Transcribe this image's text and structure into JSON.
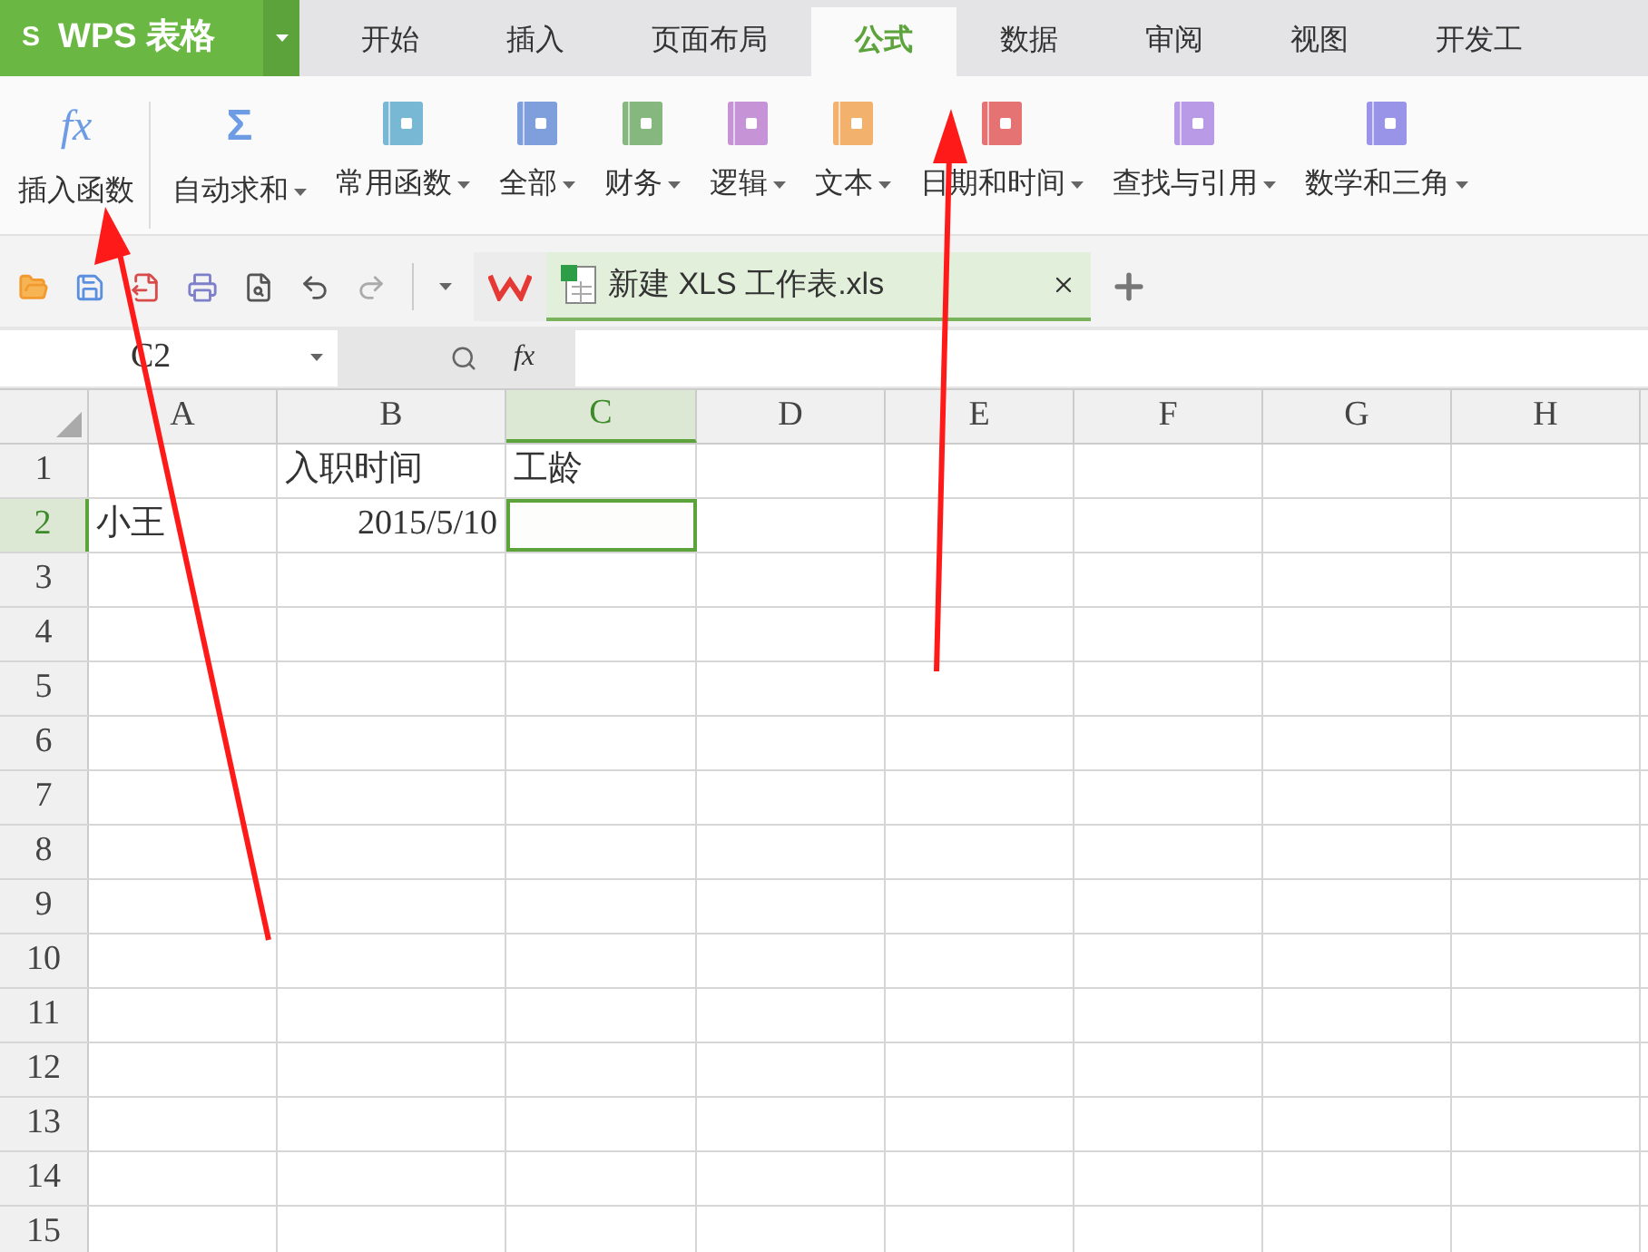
{
  "app_button": {
    "label": "WPS 表格",
    "logo": "S"
  },
  "tabs": [
    {
      "label": "开始",
      "selected": false
    },
    {
      "label": "插入",
      "selected": false
    },
    {
      "label": "页面布局",
      "selected": false
    },
    {
      "label": "公式",
      "selected": true
    },
    {
      "label": "数据",
      "selected": false
    },
    {
      "label": "审阅",
      "selected": false
    },
    {
      "label": "视图",
      "selected": false
    },
    {
      "label": "开发工",
      "selected": false
    }
  ],
  "ribbon": [
    {
      "kind": "glyph",
      "icon_text": "fx",
      "label": "插入函数",
      "has_menu": false
    },
    {
      "kind": "glyph",
      "icon_text": "Σ",
      "label": "自动求和",
      "has_menu": true
    },
    {
      "kind": "book",
      "color": "#78b8d4",
      "label": "常用函数",
      "has_menu": true
    },
    {
      "kind": "book",
      "color": "#7f9fdc",
      "label": "全部",
      "has_menu": true
    },
    {
      "kind": "book",
      "color": "#86b77e",
      "label": "财务",
      "has_menu": true
    },
    {
      "kind": "book",
      "color": "#c694d6",
      "label": "逻辑",
      "has_menu": true
    },
    {
      "kind": "book",
      "color": "#f2b26e",
      "label": "文本",
      "has_menu": true
    },
    {
      "kind": "book",
      "color": "#e57373",
      "label": "日期和时间",
      "has_menu": true
    },
    {
      "kind": "book",
      "color": "#b99ae6",
      "label": "查找与引用",
      "has_menu": true
    },
    {
      "kind": "book",
      "color": "#9a94e8",
      "label": "数学和三角",
      "has_menu": true
    }
  ],
  "document_tab": {
    "title": "新建 XLS 工作表.xls",
    "selected": true
  },
  "name_box": {
    "value": "C2"
  },
  "formula_bar": {
    "fx_label": "fx"
  },
  "sheet": {
    "columns": [
      {
        "label": "A",
        "selected": false
      },
      {
        "label": "B",
        "selected": false
      },
      {
        "label": "C",
        "selected": true
      },
      {
        "label": "D",
        "selected": false
      },
      {
        "label": "E",
        "selected": false
      },
      {
        "label": "F",
        "selected": false
      },
      {
        "label": "G",
        "selected": false
      },
      {
        "label": "H",
        "selected": false
      }
    ],
    "rows": [
      {
        "label": "1",
        "selected": false,
        "cells": [
          {
            "selected": false
          },
          {
            "text": "入职时间",
            "kind": "text",
            "selected": false
          },
          {
            "text": "工龄",
            "kind": "text",
            "selected": false
          },
          {
            "selected": false
          },
          {
            "selected": false
          },
          {
            "selected": false
          },
          {
            "selected": false
          },
          {
            "selected": false
          }
        ]
      },
      {
        "label": "2",
        "selected": true,
        "cells": [
          {
            "text": "小王",
            "kind": "text",
            "selected": false
          },
          {
            "text": "2015/5/10",
            "kind": "number",
            "selected": false
          },
          {
            "selected": true
          },
          {
            "selected": false
          },
          {
            "selected": false
          },
          {
            "selected": false
          },
          {
            "selected": false
          },
          {
            "selected": false
          }
        ]
      },
      {
        "label": "3",
        "selected": false
      },
      {
        "label": "4",
        "selected": false
      },
      {
        "label": "5",
        "selected": false
      },
      {
        "label": "6",
        "selected": false
      },
      {
        "label": "7",
        "selected": false
      },
      {
        "label": "8",
        "selected": false
      },
      {
        "label": "9",
        "selected": false
      },
      {
        "label": "10",
        "selected": false
      },
      {
        "label": "11",
        "selected": false
      },
      {
        "label": "12",
        "selected": false
      },
      {
        "label": "13",
        "selected": false
      },
      {
        "label": "14",
        "selected": false
      },
      {
        "label": "15",
        "selected": false
      }
    ]
  }
}
